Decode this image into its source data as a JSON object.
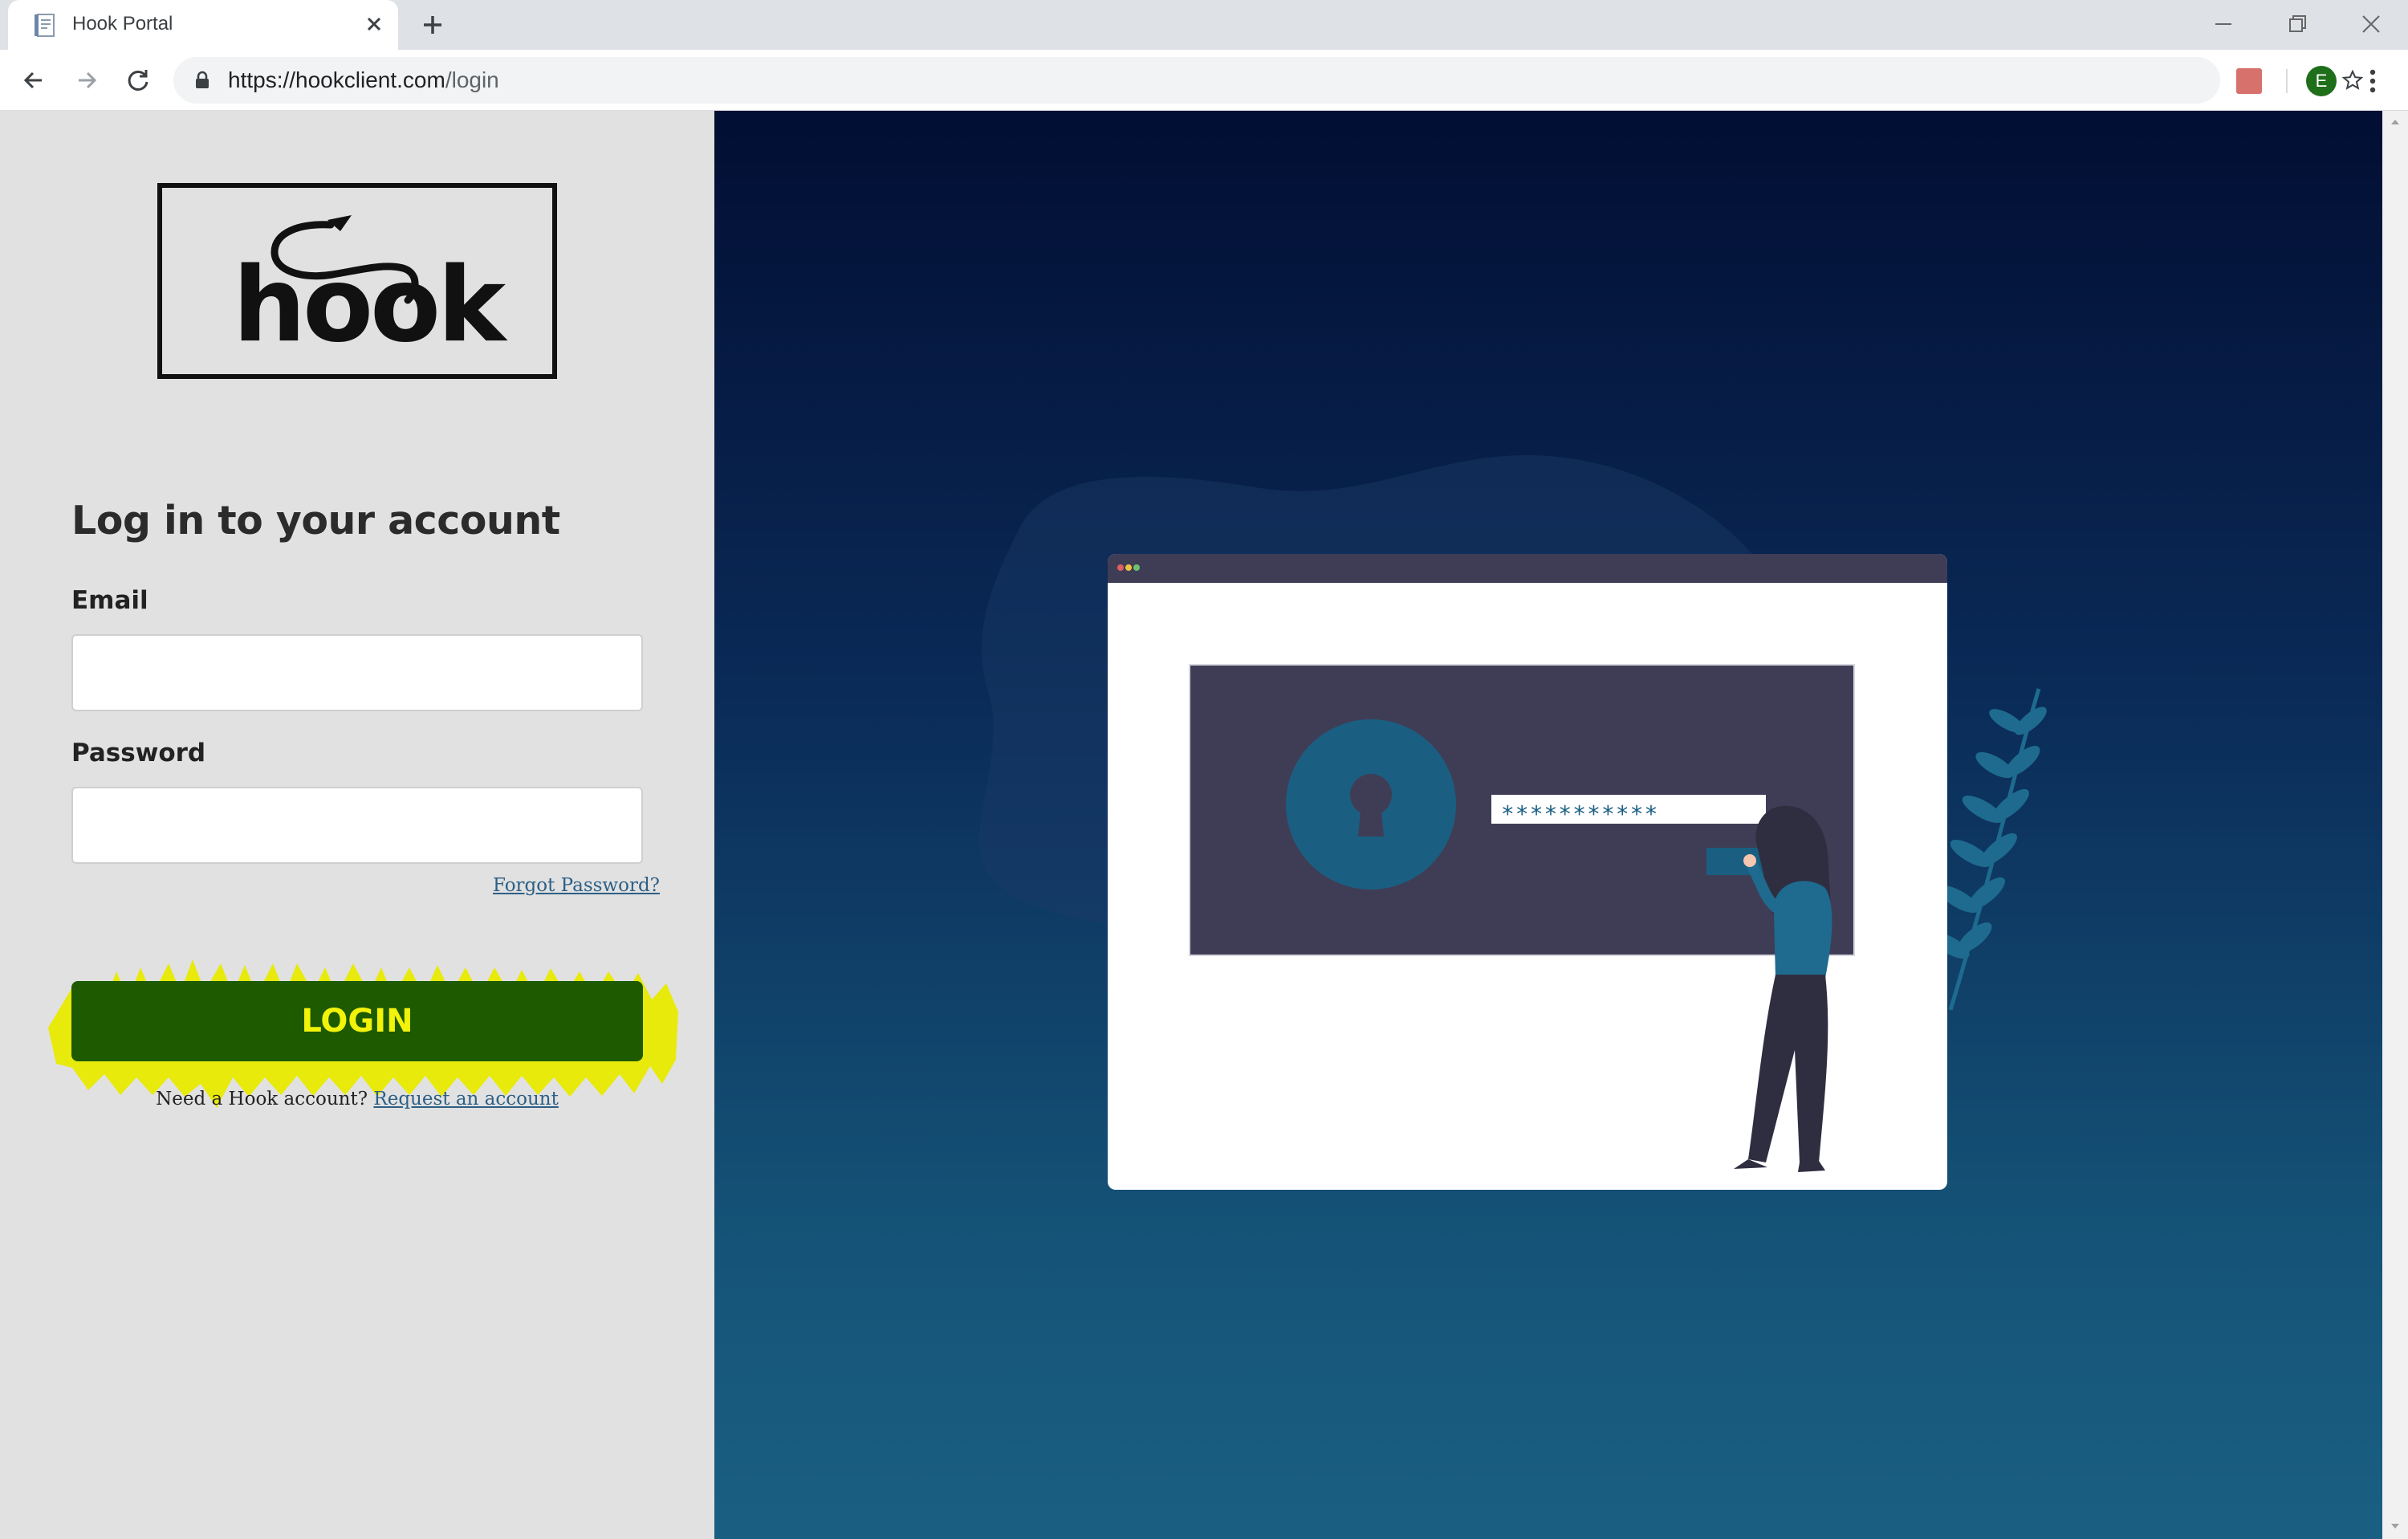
{
  "browser": {
    "tab_title": "Hook Portal",
    "url_host": "https://hookclient.com",
    "url_path": "/login",
    "profile_initial": "E",
    "icons": {
      "favicon": "document-icon",
      "tab_close": "close-icon",
      "new_tab": "plus-icon",
      "back": "arrow-left-icon",
      "forward": "arrow-right-icon",
      "reload": "reload-icon",
      "lock": "lock-icon",
      "bookmark": "star-icon",
      "extension": "pdf-icon",
      "menu": "kebab-menu-icon"
    }
  },
  "login": {
    "logo_text": "hook",
    "heading": "Log in to your account",
    "email_label": "Email",
    "email_value": "",
    "password_label": "Password",
    "password_value": "",
    "forgot_link": "Forgot Password?",
    "submit_label": "LOGIN",
    "request_prompt": "Need a Hook account?",
    "request_link": "Request an account"
  },
  "illustration": {
    "masked_password": "∗∗∗∗∗∗∗∗∗∗∗"
  },
  "colors": {
    "login_button_bg": "#1d5a00",
    "login_button_text": "#f2f20a",
    "highlight": "#e8ea00",
    "link": "#2c5f86",
    "panel_bg": "#e1e1e1"
  }
}
